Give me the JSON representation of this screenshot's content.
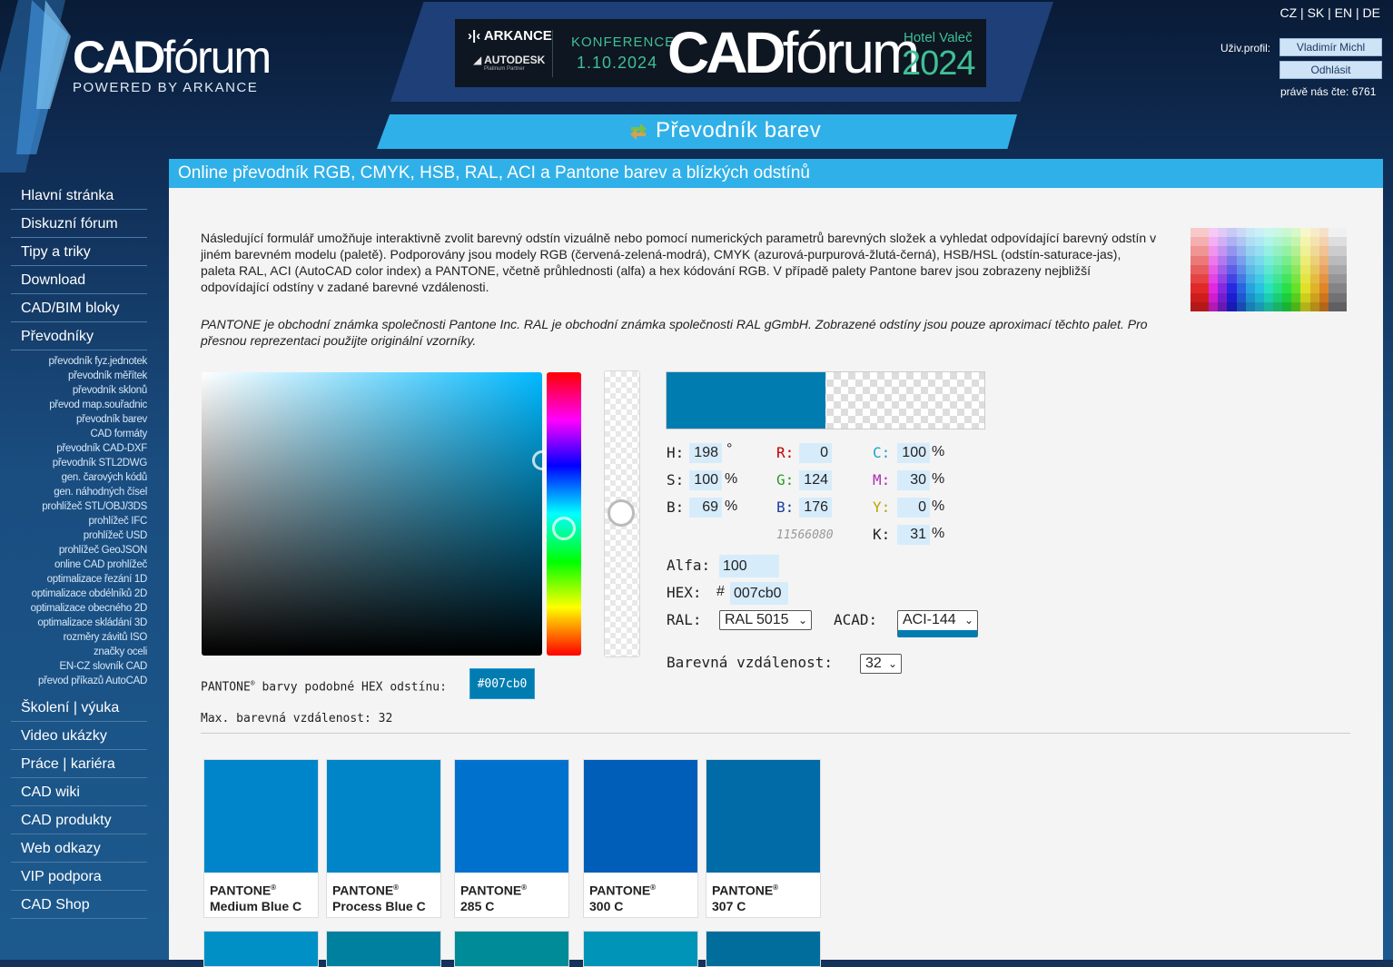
{
  "header": {
    "logo_main": "CAD",
    "logo_thin": "fórum",
    "logo_sub": "POWERED BY ARKANCE",
    "banner": {
      "arkance": "ARKANCE",
      "autodesk": "AUTODESK",
      "partner": "Platinum Partner",
      "konference": "KONFERENCE",
      "date": "1.10.2024",
      "cad": "CAD",
      "forum": "fórum",
      "hotel": "Hotel Valeč",
      "year": "2024"
    },
    "languages": [
      "CZ",
      "SK",
      "EN",
      "DE"
    ],
    "profile_label": "Uživ.profil:",
    "user_name": "Vladimír Michl",
    "logout_label": "Odhlásit",
    "reading_now": "právě nás čte: 6761",
    "section_title": "Převodník barev"
  },
  "sidebar": {
    "top_items": [
      "Hlavní stránka",
      "Diskuzní fórum",
      "Tipy a triky",
      "Download",
      "CAD/BIM bloky",
      "Převodníky"
    ],
    "sub_items": [
      "převodník fyz.jednotek",
      "převodník měřítek",
      "převodník sklonů",
      "převod map.souřadnic",
      "převodník barev",
      "CAD formáty",
      "převodník CAD-DXF",
      "převodník STL2DWG",
      "gen. čarových kódů",
      "gen. náhodných čísel",
      "prohlížeč STL/OBJ/3DS",
      "prohlížeč IFC",
      "prohlížeč USD",
      "prohlížeč GeoJSON",
      "online CAD prohlížeč",
      "optimalizace řezání 1D",
      "optimalizace obdélníků 2D",
      "optimalizace obecného 2D",
      "optimalizace skládání 3D",
      "rozměry závitů ISO",
      "značky oceli",
      "EN-CZ slovník CAD",
      "převod příkazů AutoCAD"
    ],
    "bottom_items": [
      "Školení | výuka",
      "Video ukázky",
      "Práce | kariéra",
      "CAD wiki",
      "CAD produkty",
      "Web odkazy",
      "VIP podpora",
      "CAD Shop"
    ]
  },
  "content": {
    "title": "Online převodník RGB, CMYK, HSB, RAL, ACI a Pantone barev a blízkých odstínů",
    "intro": "Následující formulář umožňuje interaktivně zvolit barevný odstín vizuálně nebo pomocí numerických parametrů barevných složek a vyhledat odpovídající barevný odstín v jiném barevném modelu (paletě). Podporovány jsou modely RGB (červená-zelená-modrá), CMYK (azurová-purpurová-žlutá-černá), HSB/HSL (odstín-saturace-jas), paleta RAL, ACI (AutoCAD color index) a PANTONE, včetně průhlednosti (alfa) a hex kódování RGB. V případě palety Pantone barev jsou zobrazeny nejbližší odpovídající odstíny v zadané barevné vzdálenosti.",
    "disclaimer": "PANTONE je obchodní známka společnosti Pantone Inc. RAL je obchodní známka společnosti RAL gGmbH. Zobrazené odstíny jsou pouze aproximací těchto palet. Pro přesnou reprezentaci použijte originální vzorníky."
  },
  "converter": {
    "current_color": "#007cb0",
    "hue_fraction": 0.55,
    "saturation": 100,
    "brightness": 69,
    "hsb": {
      "h_label": "H:",
      "h": "198",
      "h_unit": "°",
      "s_label": "S:",
      "s": "100",
      "s_unit": "%",
      "b_label": "B:",
      "b": "69",
      "b_unit": "%"
    },
    "rgb": {
      "r_label": "R:",
      "r": "0",
      "g_label": "G:",
      "g": "124",
      "b_label": "B:",
      "b": "176",
      "decimal": "11566080"
    },
    "cmyk": {
      "c_label": "C:",
      "c": "100",
      "m_label": "M:",
      "m": "30",
      "y_label": "Y:",
      "y": "0",
      "k_label": "K:",
      "k": "31",
      "unit": "%"
    },
    "alpha_label": "Alfa:",
    "alpha": "100",
    "hex_label": "HEX:",
    "hex_hash": "#",
    "hex": "007cb0",
    "ral_label": "RAL:",
    "ral": "RAL 5015",
    "acad_label": "ACAD:",
    "acad": "ACI-144",
    "distance_label": "Barevná vzdálenost:",
    "distance": "32",
    "pantone_prefix": "PANTONE",
    "pantone_reg": "®",
    "pantone_suffix": " barvy podobné HEX odstínu:",
    "pantone_hex": "#007cb0",
    "max_distance": "Max. barevná vzdálenost: 32"
  },
  "pantone_results": [
    {
      "line1": "PANTONE",
      "line2": "Medium Blue C",
      "color": "#0085ca"
    },
    {
      "line1": "PANTONE",
      "line2": "Process Blue C",
      "color": "#0085c8"
    },
    {
      "line1": "PANTONE",
      "line2": "285 C",
      "color": "#0072ce"
    },
    {
      "line1": "PANTONE",
      "line2": "300 C",
      "color": "#005eb8"
    },
    {
      "line1": "PANTONE",
      "line2": "307 C",
      "color": "#006ba6"
    }
  ],
  "pantone_next_row_colors": [
    "#0090c6",
    "#00809f",
    "#008b98",
    "#0094b8",
    "#006d9c"
  ],
  "colors": {
    "header_blue": "#30b0e8",
    "nav_bg": "#14325a",
    "field_bg": "#d7ecfb"
  }
}
